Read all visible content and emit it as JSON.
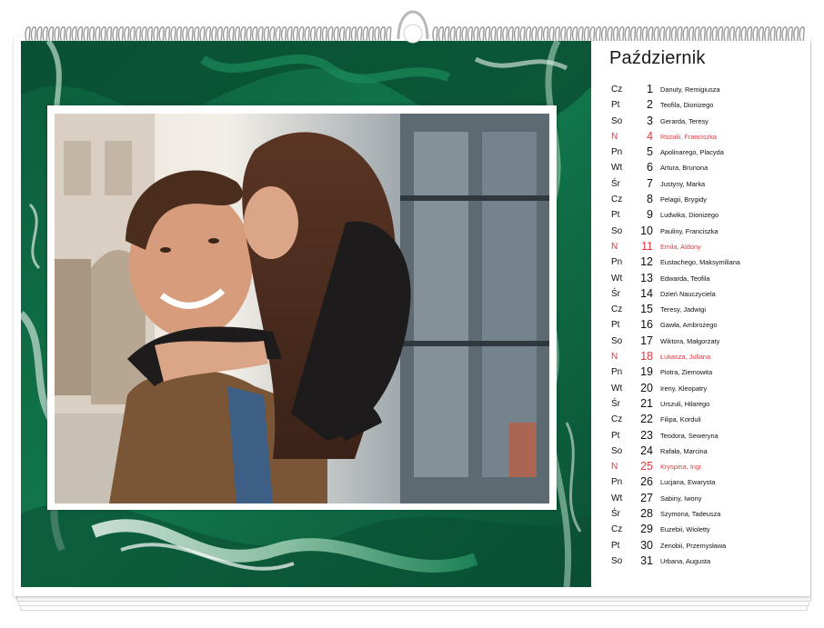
{
  "calendar": {
    "month": "Październik",
    "sunday_color": "#e0383e",
    "marble_colors": [
      "#0e6a45",
      "#1b8a5a",
      "#b9ddc8",
      "#e9f4ee",
      "#0a4f33"
    ],
    "days": [
      {
        "dow": "Cz",
        "num": "1",
        "names": "Danuty, Remigiusza",
        "sunday": false
      },
      {
        "dow": "Pt",
        "num": "2",
        "names": "Teofila, Dionizego",
        "sunday": false
      },
      {
        "dow": "So",
        "num": "3",
        "names": "Gerarda, Teresy",
        "sunday": false
      },
      {
        "dow": "N",
        "num": "4",
        "names": "Rozalii, Franciszka",
        "sunday": true
      },
      {
        "dow": "Pn",
        "num": "5",
        "names": "Apolinarego, Placyda",
        "sunday": false
      },
      {
        "dow": "Wt",
        "num": "6",
        "names": "Artura, Brunona",
        "sunday": false
      },
      {
        "dow": "Śr",
        "num": "7",
        "names": "Justyny, Marka",
        "sunday": false
      },
      {
        "dow": "Cz",
        "num": "8",
        "names": "Pelagii, Brygidy",
        "sunday": false
      },
      {
        "dow": "Pt",
        "num": "9",
        "names": "Ludwika, Dionizego",
        "sunday": false
      },
      {
        "dow": "So",
        "num": "10",
        "names": "Pauliny, Franciszka",
        "sunday": false
      },
      {
        "dow": "N",
        "num": "11",
        "names": "Emila, Aldony",
        "sunday": true
      },
      {
        "dow": "Pn",
        "num": "12",
        "names": "Eustachego, Maksymiliana",
        "sunday": false
      },
      {
        "dow": "Wt",
        "num": "13",
        "names": "Edwarda, Teofila",
        "sunday": false
      },
      {
        "dow": "Śr",
        "num": "14",
        "names": "Dzień Nauczyciela",
        "sunday": false
      },
      {
        "dow": "Cz",
        "num": "15",
        "names": "Teresy, Jadwigi",
        "sunday": false
      },
      {
        "dow": "Pt",
        "num": "16",
        "names": "Gawła, Ambrożego",
        "sunday": false
      },
      {
        "dow": "So",
        "num": "17",
        "names": "Wiktora, Małgorzaty",
        "sunday": false
      },
      {
        "dow": "N",
        "num": "18",
        "names": "Łukasza, Juliana",
        "sunday": true
      },
      {
        "dow": "Pn",
        "num": "19",
        "names": "Piotra, Ziemowita",
        "sunday": false
      },
      {
        "dow": "Wt",
        "num": "20",
        "names": "Ireny, Kleopatry",
        "sunday": false
      },
      {
        "dow": "Śr",
        "num": "21",
        "names": "Urszuli, Hilarego",
        "sunday": false
      },
      {
        "dow": "Cz",
        "num": "22",
        "names": "Filipa, Korduli",
        "sunday": false
      },
      {
        "dow": "Pt",
        "num": "23",
        "names": "Teodora, Seweryna",
        "sunday": false
      },
      {
        "dow": "So",
        "num": "24",
        "names": "Rafała, Marcina",
        "sunday": false
      },
      {
        "dow": "N",
        "num": "25",
        "names": "Kryspina, Ingi",
        "sunday": true
      },
      {
        "dow": "Pn",
        "num": "26",
        "names": "Lucjana, Ewarysta",
        "sunday": false
      },
      {
        "dow": "Wt",
        "num": "27",
        "names": "Sabiny, Iwony",
        "sunday": false
      },
      {
        "dow": "Śr",
        "num": "28",
        "names": "Szymona, Tadeusza",
        "sunday": false
      },
      {
        "dow": "Cz",
        "num": "29",
        "names": "Euzebii, Wioletty",
        "sunday": false
      },
      {
        "dow": "Pt",
        "num": "30",
        "names": "Zenobii, Przemysława",
        "sunday": false
      },
      {
        "dow": "So",
        "num": "31",
        "names": "Urbana, Augusta",
        "sunday": false
      }
    ]
  }
}
